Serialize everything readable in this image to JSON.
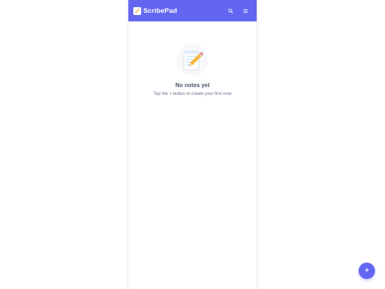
{
  "app": {
    "title": "ScribePad",
    "brand_icon": "pencil-note-icon",
    "accent_color": "#6366f1"
  },
  "header": {
    "actions": [
      {
        "icon": "search-icon"
      },
      {
        "icon": "menu-icon"
      }
    ]
  },
  "empty_state": {
    "illustration": "memo-icon",
    "title": "No notes yet",
    "subtitle": "Tap the + button to create your first note"
  },
  "fab": {
    "label": "+",
    "icon": "add-icon"
  }
}
